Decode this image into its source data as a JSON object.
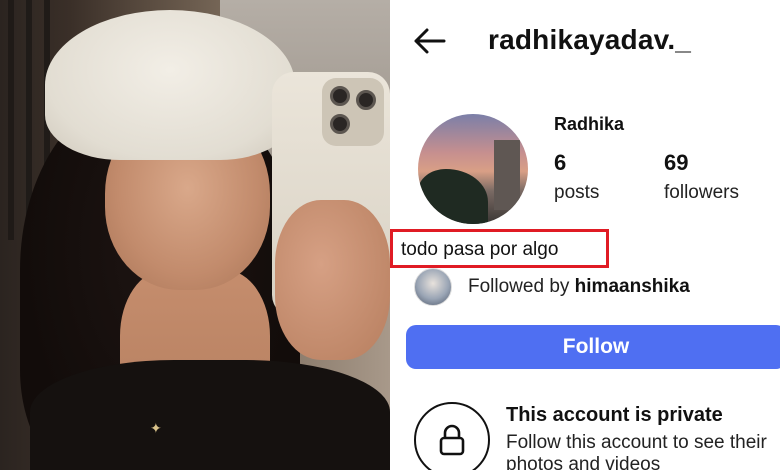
{
  "header": {
    "username": "radhikayadav._",
    "back_icon": "arrow-left-icon"
  },
  "profile": {
    "display_name": "Radhika",
    "stats": [
      {
        "value": "6",
        "label": "posts"
      },
      {
        "value": "69",
        "label": "followers"
      }
    ],
    "bio": "todo pasa por algo",
    "highlight_color": "#e01b24"
  },
  "mutual": {
    "prefix": "Followed by ",
    "username": "himaanshika"
  },
  "actions": {
    "follow_label": "Follow",
    "follow_color": "#4f6ff2"
  },
  "private_notice": {
    "icon": "lock-icon",
    "title": "This account is private",
    "subtitle": "Follow this account to see their photos and videos"
  }
}
